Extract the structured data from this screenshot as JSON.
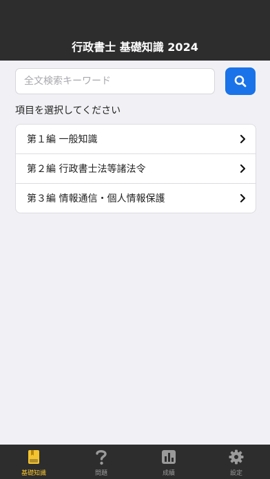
{
  "header": {
    "title": "行政書士 基礎知識 2024"
  },
  "search": {
    "placeholder": "全文検索キーワード",
    "value": "",
    "button_icon": "search-icon"
  },
  "prompt": "項目を選択してください",
  "items": [
    {
      "label": "第１編 一般知識"
    },
    {
      "label": "第２編 行政書士法等諸法令"
    },
    {
      "label": "第３編 情報通信・個人情報保護"
    }
  ],
  "tabs": [
    {
      "label": "基礎知識",
      "icon": "book-icon",
      "active": true
    },
    {
      "label": "問題",
      "icon": "question-icon",
      "active": false
    },
    {
      "label": "成績",
      "icon": "chart-icon",
      "active": false
    },
    {
      "label": "設定",
      "icon": "gear-icon",
      "active": false
    }
  ],
  "colors": {
    "header_bg": "#2d2d2d",
    "accent_blue": "#1a73e8",
    "active_tab": "#f4c430",
    "inactive_tab": "#9a9a9a",
    "page_bg": "#f1f1f5"
  }
}
